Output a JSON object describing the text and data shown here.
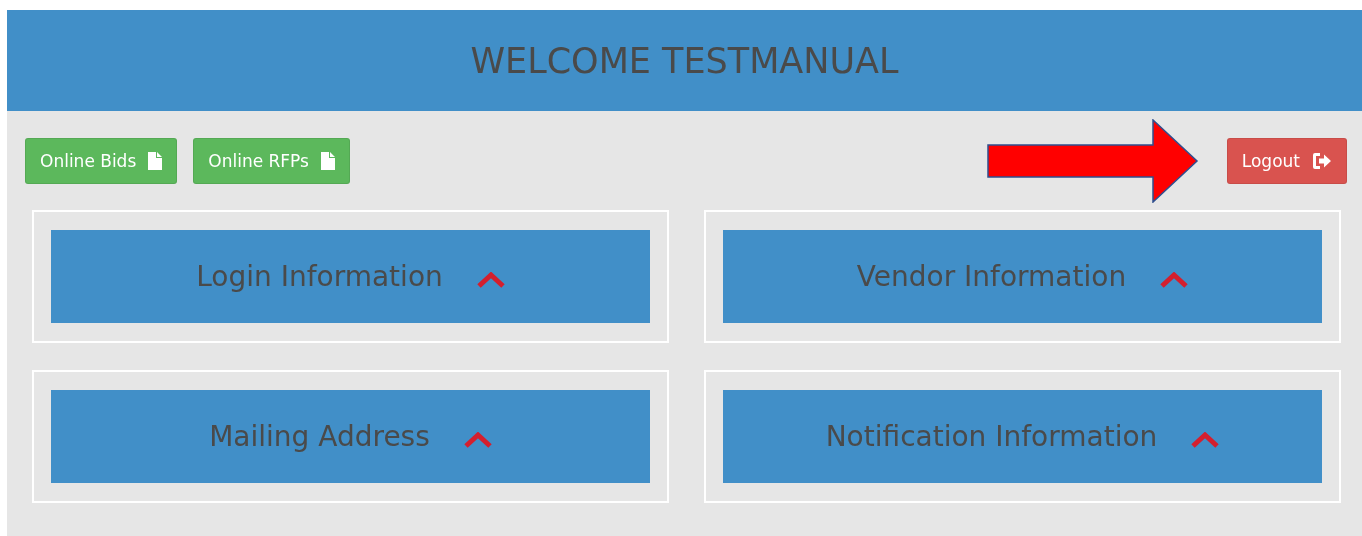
{
  "header": {
    "title": "WELCOME TESTMANUAL"
  },
  "toolbar": {
    "left_buttons": [
      {
        "label": "Online Bids",
        "kind": "document"
      },
      {
        "label": "Online RFPs",
        "kind": "document"
      }
    ],
    "right_buttons": [
      {
        "label": "Logout",
        "kind": "logout"
      }
    ]
  },
  "sections": [
    {
      "title": "Login Information",
      "expanded": true
    },
    {
      "title": "Vendor Information",
      "expanded": true
    },
    {
      "title": "Mailing Address",
      "expanded": true
    },
    {
      "title": "Notification Information",
      "expanded": true
    }
  ]
}
